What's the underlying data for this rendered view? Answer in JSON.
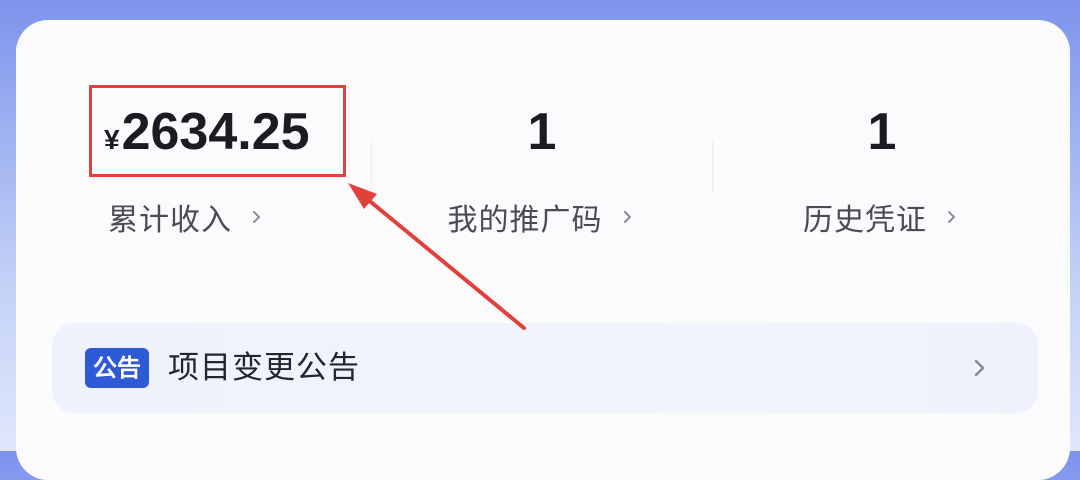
{
  "summary": {
    "income": {
      "currency": "¥",
      "amount": "2634.25",
      "label": "累计收入"
    },
    "promo_codes": {
      "count": "1",
      "label": "我的推广码"
    },
    "voucher_history": {
      "count": "1",
      "label": "历史凭证"
    }
  },
  "notice": {
    "badge": "公告",
    "text": "项目变更公告"
  },
  "icons": {
    "label_chevron": "chevron-right-icon",
    "notice_chevron": "chevron-right-icon"
  },
  "colors": {
    "background_top": "#7d93ec",
    "card": "#fbfbfd",
    "badge": "#2f5ad6",
    "annotation": "#e2413b"
  }
}
